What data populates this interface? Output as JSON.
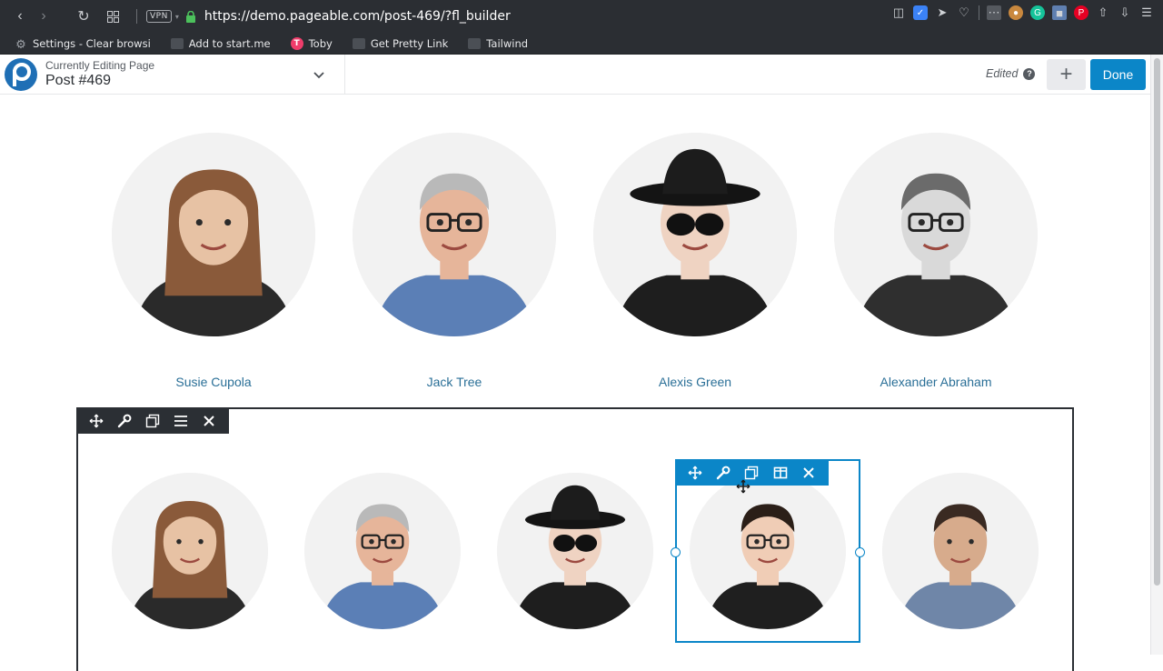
{
  "browser": {
    "url": "https://demo.pageable.com/post-469/?fl_builder",
    "vpn_label": "VPN"
  },
  "bookmarks": [
    {
      "label": "Settings - Clear browsi",
      "icon": "gear-icon"
    },
    {
      "label": "Add to start.me",
      "icon": "folder-icon"
    },
    {
      "label": "Toby",
      "icon": "toby-icon"
    },
    {
      "label": "Get Pretty Link",
      "icon": "folder-icon"
    },
    {
      "label": "Tailwind",
      "icon": "folder-icon"
    }
  ],
  "builder": {
    "editing_label": "Currently Editing Page",
    "page_title": "Post #469",
    "status": "Edited",
    "help_glyph": "?",
    "done_label": "Done",
    "accent": "#0b86c8"
  },
  "team": [
    {
      "name": "Susie Cupola",
      "skin": "#e7c2a4",
      "hair": "#8a5a3a",
      "shirt": "#2a2a2a",
      "accessory": "none"
    },
    {
      "name": "Jack Tree",
      "skin": "#e6b59a",
      "hair": "#b9b9b9",
      "shirt": "#5b7fb6",
      "accessory": "glasses"
    },
    {
      "name": "Alexis Green",
      "skin": "#efd3c2",
      "hair": "#1d1d1d",
      "shirt": "#1e1e1e",
      "accessory": "hat"
    },
    {
      "name": "Alexander Abraham",
      "skin": "#d9d9d9",
      "hair": "#6b6b6b",
      "shirt": "#2f2f2f",
      "accessory": "glasses"
    }
  ],
  "row_avatars": [
    {
      "label": "avatar-susie",
      "skin": "#e7c2a4",
      "hair": "#8a5a3a",
      "shirt": "#2a2a2a",
      "accessory": "none"
    },
    {
      "label": "avatar-jack",
      "skin": "#e6b59a",
      "hair": "#b9b9b9",
      "shirt": "#5b7fb6",
      "accessory": "glasses"
    },
    {
      "label": "avatar-alexis",
      "skin": "#efd3c2",
      "hair": "#1d1d1d",
      "shirt": "#1e1e1e",
      "accessory": "hat"
    },
    {
      "label": "avatar-man-glasses",
      "skin": "#f0cdb6",
      "hair": "#2b1f18",
      "shirt": "#1f1f1f",
      "accessory": "glasses"
    },
    {
      "label": "avatar-man-plaid",
      "skin": "#d7ab8c",
      "hair": "#3a2a22",
      "shirt": "#6f86a8",
      "accessory": "none"
    }
  ]
}
